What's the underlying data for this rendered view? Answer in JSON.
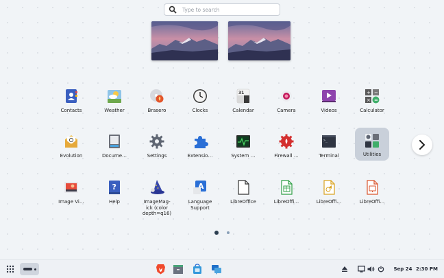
{
  "search": {
    "placeholder": "Type to search"
  },
  "workspaces": [
    {
      "name": "workspace-1"
    },
    {
      "name": "workspace-2"
    }
  ],
  "apps": [
    {
      "label": "Contacts",
      "icon": "contacts-icon"
    },
    {
      "label": "Weather",
      "icon": "weather-icon"
    },
    {
      "label": "Brasero",
      "icon": "brasero-icon"
    },
    {
      "label": "Clocks",
      "icon": "clocks-icon"
    },
    {
      "label": "Calendar",
      "icon": "calendar-icon",
      "day": "31"
    },
    {
      "label": "Camera",
      "icon": "camera-icon"
    },
    {
      "label": "Videos",
      "icon": "videos-icon"
    },
    {
      "label": "Calculator",
      "icon": "calculator-icon"
    },
    {
      "label": "Evolution",
      "icon": "evolution-icon"
    },
    {
      "label": "Docume…",
      "icon": "document-viewer-icon"
    },
    {
      "label": "Settings",
      "icon": "settings-icon"
    },
    {
      "label": "Extensio…",
      "icon": "extensions-icon"
    },
    {
      "label": "System …",
      "icon": "system-monitor-icon"
    },
    {
      "label": "Firewall …",
      "icon": "firewall-icon"
    },
    {
      "label": "Terminal",
      "icon": "terminal-icon"
    },
    {
      "label": "Utilities",
      "icon": "utilities-folder-icon",
      "selected": true
    },
    {
      "label": "Image Vi…",
      "icon": "image-viewer-icon"
    },
    {
      "label": "Help",
      "icon": "help-icon"
    },
    {
      "label": "ImageMag-\nick (color\ndepth=q16)",
      "icon": "imagemagick-icon"
    },
    {
      "label": "Language\nSupport",
      "icon": "language-support-icon"
    },
    {
      "label": "LibreOffice",
      "icon": "libreoffice-icon"
    },
    {
      "label": "LibreOffi…",
      "icon": "libreoffice-calc-icon"
    },
    {
      "label": "LibreOffi…",
      "icon": "libreoffice-draw-icon"
    },
    {
      "label": "LibreOffi…",
      "icon": "libreoffice-impress-icon"
    }
  ],
  "pagination": {
    "pages": 2,
    "current": 1
  },
  "taskbar": {
    "date": "Sep 24",
    "time": "2:30 PM",
    "pinned": [
      "brave-browser-icon",
      "file-manager-icon",
      "software-store-icon",
      "messages-icon"
    ]
  },
  "colors": {
    "accent": "#2c3e50",
    "selected_bg": "#c9d0da"
  }
}
